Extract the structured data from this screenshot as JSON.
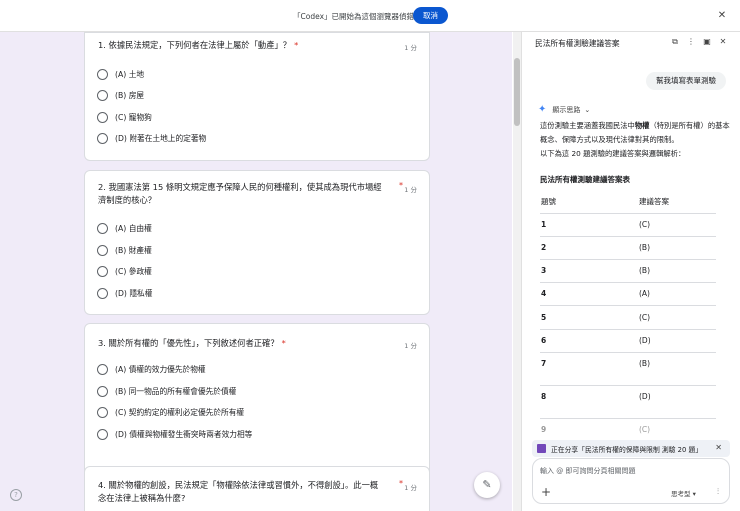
{
  "topbar": {
    "message": "「Codex」已開始為這個瀏覽器偵錯",
    "cancel_label": "取消"
  },
  "form": {
    "questions": [
      {
        "title": "1. 依據民法規定，下列何者在法律上屬於「動產」？",
        "required": "*",
        "points": "1 分",
        "options": [
          "(A) 土地",
          "(B) 房屋",
          "(C) 寵物狗",
          "(D) 附著在土地上的定著物"
        ]
      },
      {
        "title_line1": "2. 我國憲法第 15 條明文規定應予保障人民的何種權利，使其成為現代市場經",
        "title_line2": "濟制度的核心？",
        "required": "*",
        "points": "1 分",
        "options": [
          "(A) 自由權",
          "(B) 財產權",
          "(C) 參政權",
          "(D) 隱私權"
        ]
      },
      {
        "title": "3. 關於所有權的「優先性」，下列敘述何者正確？",
        "required": "*",
        "points": "1 分",
        "options": [
          "(A) 債權的效力優先於物權",
          "(B) 同一物品的所有權會優先於債權",
          "(C) 契約約定的權利必定優先於所有權",
          "(D) 債權與物權發生衝突時兩者效力相等"
        ]
      },
      {
        "title_line1": "4. 關於物權的創設，民法規定「物權除依法律或習慣外，不得創設」。此一概",
        "title_line2": "念在法律上被稱為什麼?",
        "required": "*",
        "points": "1 分"
      }
    ],
    "help_icon": "help-circle-icon",
    "fab_icon": "pencil-icon"
  },
  "panel": {
    "title": "民法所有權測驗建議答案",
    "icons": [
      "open-in-new-icon",
      "more-vert-icon",
      "sidebar-icon",
      "close-icon"
    ],
    "user_message": "幫我填寫表單測驗",
    "thinking_label": "顯示思路",
    "para1_a": "這份測驗主要涵蓋我國民法中",
    "para1_b": "物權",
    "para1_c": "（特別是所有權）的基本概念、保障方式以及現代法律對其的限制。",
    "para2": "以下為這 20 題測驗的建議答案與邏輯解析：",
    "table_title": "民法所有權測驗建議答案表",
    "col_num": "題號",
    "col_ans": "建議答案",
    "rows": [
      {
        "num": "1",
        "ans": "(C)"
      },
      {
        "num": "2",
        "ans": "(B)"
      },
      {
        "num": "3",
        "ans": "(B)"
      },
      {
        "num": "4",
        "ans": "(A)"
      },
      {
        "num": "5",
        "ans": "(C)"
      },
      {
        "num": "6",
        "ans": "(D)"
      },
      {
        "num": "7",
        "ans": "(B)"
      },
      {
        "num": "8",
        "ans": "(D)"
      },
      {
        "num": "9",
        "ans": "(C)"
      }
    ],
    "share_text": "正在分享「民法所有權的保障與限制 測驗 20 題」",
    "input_placeholder": "輸入 @ 即可詢問分頁相關問題",
    "mode_label": "思考型 ▾"
  }
}
